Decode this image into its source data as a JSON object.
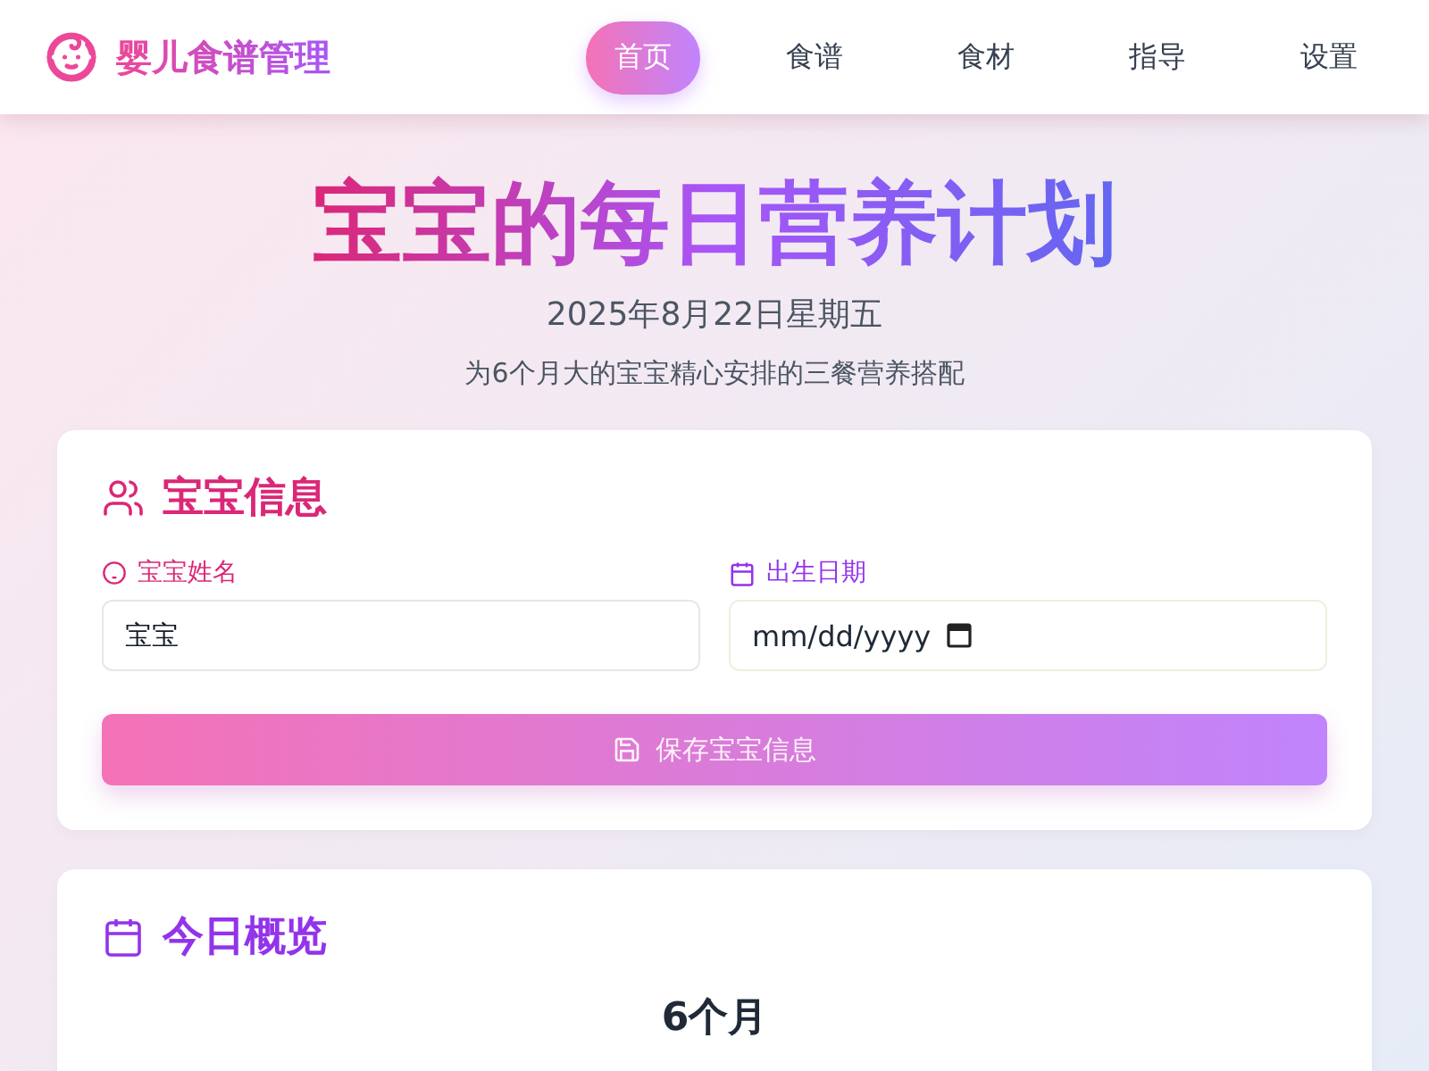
{
  "app": {
    "title": "婴儿食谱管理"
  },
  "nav": [
    {
      "label": "首页",
      "selected": true
    },
    {
      "label": "食谱",
      "selected": false
    },
    {
      "label": "食材",
      "selected": false
    },
    {
      "label": "指导",
      "selected": false
    },
    {
      "label": "设置",
      "selected": false
    }
  ],
  "hero": {
    "title": "宝宝的每日营养计划",
    "date": "2025年8月22日星期五",
    "subtitle": "为6个月大的宝宝精心安排的三餐营养搭配"
  },
  "baby_info": {
    "title": "宝宝信息",
    "name_label": "宝宝姓名",
    "name_value": "宝宝",
    "birth_label": "出生日期",
    "birth_placeholder": "mm/dd/yyyy",
    "save_button": "保存宝宝信息"
  },
  "overview": {
    "title": "今日概览",
    "age": "6个月"
  }
}
